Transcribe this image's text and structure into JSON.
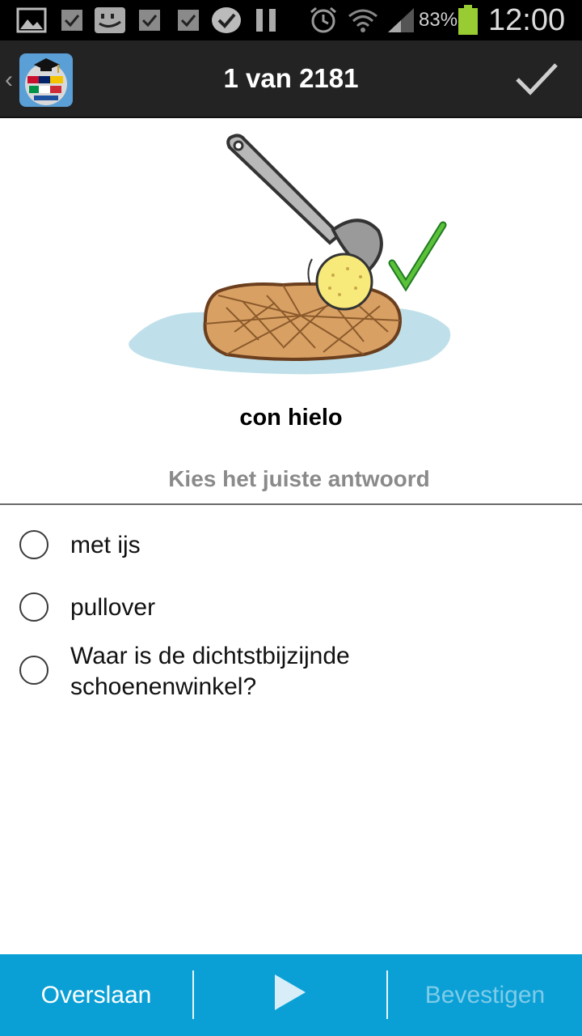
{
  "status_bar": {
    "battery_percent": "83%",
    "time": "12:00",
    "icons": [
      "gallery-icon",
      "checkbox-icon",
      "messenger-icon",
      "checkbox-icon",
      "checkbox-icon",
      "clipboard-check-icon",
      "pause-icon",
      "alarm-icon",
      "wifi-icon",
      "signal-icon",
      "battery-icon"
    ]
  },
  "action_bar": {
    "title": "1 van 2181",
    "up_icon": "chevron-left-icon",
    "logo_icon": "language-globe-icon",
    "confirm_icon": "check-icon"
  },
  "question": {
    "word": "con hielo",
    "instruction": "Kies het juiste antwoord",
    "illustration_icon": "waffle-with-ice-cream-icon"
  },
  "options": [
    {
      "label": "met ijs",
      "selected": false
    },
    {
      "label": "pullover",
      "selected": false
    },
    {
      "label": "Waar is de dichtstbijzijnde schoenenwinkel?",
      "selected": false
    }
  ],
  "bottom_bar": {
    "skip_label": "Overslaan",
    "play_icon": "play-icon",
    "confirm_label": "Bevestigen"
  },
  "colors": {
    "accent": "#0aa0d6",
    "action_bar": "#232323",
    "disabled_text": "#7fcbe8",
    "instruction": "#8a8a8a"
  }
}
